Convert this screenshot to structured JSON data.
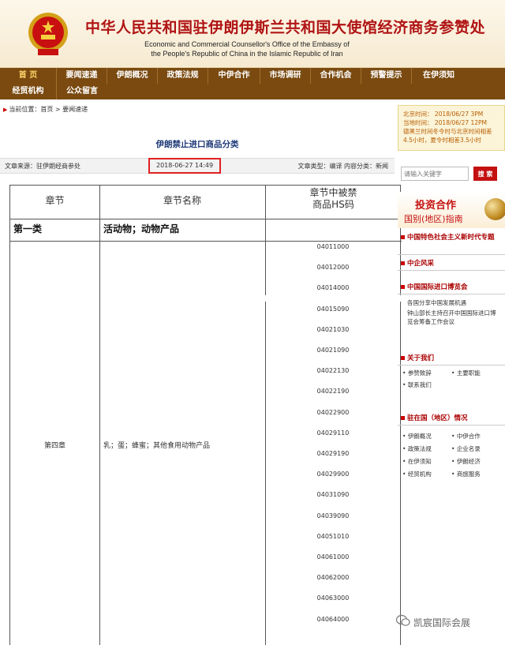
{
  "header": {
    "cn_title": "中华人民共和国驻伊朗伊斯兰共和国大使馆经济商务参赞处",
    "en_title_line1": "Economic and Commercial Counsellor's Office of the Embassy of",
    "en_title_line2": "the People's Republic of China in the Islamic Republic of Iran"
  },
  "nav": {
    "row1": [
      "首 页",
      "要闻速递",
      "伊朗概况",
      "政策法规",
      "中伊合作",
      "市场调研",
      "合作机会",
      "预警提示",
      "在伊须知"
    ],
    "row2": [
      "经贸机构",
      "公众留言"
    ]
  },
  "breadcrumb": "当前位置：首页 > 要闻速递",
  "article": {
    "title": "伊朗禁止进口商品分类",
    "source": "文章来源：驻伊朗经商参处",
    "date": "2018-06-27 14:49",
    "type": "文章类型：编译  内容分类：新闻"
  },
  "table": {
    "headers": [
      "章节",
      "章节名称",
      "章节中被禁\n商品HS码"
    ],
    "category_label": "第一类",
    "category_name": "活动物；动物产品",
    "chapter": "第四章",
    "chapter_name": "乳；蛋；蜂蜜；其他食用动物产品",
    "hs_codes": [
      "04011000",
      "04012000",
      "04014000",
      "04015090",
      "04021030",
      "04021090",
      "04022130",
      "04022190",
      "04022900",
      "04029110",
      "04029190",
      "04029900",
      "04031090",
      "04039090",
      "04051010",
      "04061000",
      "04062000",
      "04063000",
      "04064000"
    ]
  },
  "sidebar": {
    "time_lines": [
      "北京时间：  2018/06/27 3PM",
      "当地时间：  2018/06/27 12PM",
      "德黑兰时间冬令时与北京时间相差",
      "4.5小时，夏令时相差3.5小时"
    ],
    "search_placeholder": "请输入关键字",
    "search_button": "搜 索",
    "banner_line1": "投资合作",
    "banner_line2": "国别(地区)指南",
    "sec1_title": "中国特色社会主义新时代专题",
    "sec2_title": "中企风采",
    "sec3_title": "中国国际进口博览会",
    "sec3_item1": "各国分享中国发展机遇",
    "sec3_item2": "钟山部长主持召开中国国际进口博览会筹备工作会议",
    "sec4_title": "关于我们",
    "sec4_items": [
      "参赞致辞",
      "主要职能",
      "联系我们"
    ],
    "sec5_title": "驻在国（地区）情况",
    "sec5_items": [
      "伊朗概况",
      "中伊合作",
      "政策法规",
      "企业名录",
      "在伊须知",
      "伊朗经济",
      "经贸机构",
      "商旅服务"
    ]
  },
  "watermark": "凯宸国际会展"
}
